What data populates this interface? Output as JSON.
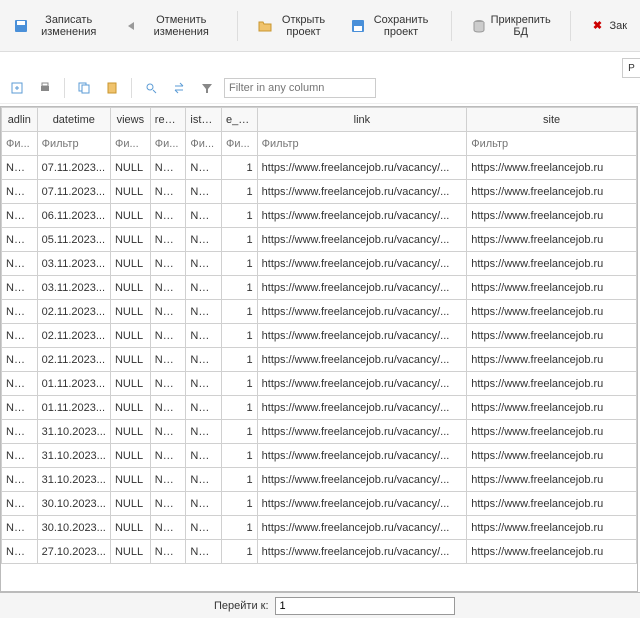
{
  "toolbar": {
    "save": "Записать изменения",
    "cancel": "Отменить изменения",
    "open": "Открыть проект",
    "saveProj": "Сохранить проект",
    "attachDb": "Прикрепить БД",
    "close": "Зак"
  },
  "tab_right": "P",
  "filter_placeholder": "Filter in any column",
  "columns": {
    "adlin": "adlin",
    "datetime": "datetime",
    "views": "views",
    "replies": "replies",
    "istom": "istomi",
    "enum": "e_num",
    "link": "link",
    "site": "site"
  },
  "filters": {
    "short": "Фи...",
    "med": "Фильтр"
  },
  "rows": [
    {
      "adlin": "NULL",
      "datetime": "07.11.2023...",
      "views": "NULL",
      "replies": "NULL",
      "istom": "NULL",
      "enum": "1",
      "link": "https://www.freelancejob.ru/vacancy/...",
      "site": "https://www.freelancejob.ru"
    },
    {
      "adlin": "NULL",
      "datetime": "07.11.2023...",
      "views": "NULL",
      "replies": "NULL",
      "istom": "NULL",
      "enum": "1",
      "link": "https://www.freelancejob.ru/vacancy/...",
      "site": "https://www.freelancejob.ru"
    },
    {
      "adlin": "NULL",
      "datetime": "06.11.2023...",
      "views": "NULL",
      "replies": "NULL",
      "istom": "NULL",
      "enum": "1",
      "link": "https://www.freelancejob.ru/vacancy/...",
      "site": "https://www.freelancejob.ru"
    },
    {
      "adlin": "NULL",
      "datetime": "05.11.2023...",
      "views": "NULL",
      "replies": "NULL",
      "istom": "NULL",
      "enum": "1",
      "link": "https://www.freelancejob.ru/vacancy/...",
      "site": "https://www.freelancejob.ru"
    },
    {
      "adlin": "NULL",
      "datetime": "03.11.2023...",
      "views": "NULL",
      "replies": "NULL",
      "istom": "NULL",
      "enum": "1",
      "link": "https://www.freelancejob.ru/vacancy/...",
      "site": "https://www.freelancejob.ru"
    },
    {
      "adlin": "NULL",
      "datetime": "03.11.2023...",
      "views": "NULL",
      "replies": "NULL",
      "istom": "NULL",
      "enum": "1",
      "link": "https://www.freelancejob.ru/vacancy/...",
      "site": "https://www.freelancejob.ru"
    },
    {
      "adlin": "NULL",
      "datetime": "02.11.2023...",
      "views": "NULL",
      "replies": "NULL",
      "istom": "NULL",
      "enum": "1",
      "link": "https://www.freelancejob.ru/vacancy/...",
      "site": "https://www.freelancejob.ru"
    },
    {
      "adlin": "NULL",
      "datetime": "02.11.2023...",
      "views": "NULL",
      "replies": "NULL",
      "istom": "NULL",
      "enum": "1",
      "link": "https://www.freelancejob.ru/vacancy/...",
      "site": "https://www.freelancejob.ru"
    },
    {
      "adlin": "NULL",
      "datetime": "02.11.2023...",
      "views": "NULL",
      "replies": "NULL",
      "istom": "NULL",
      "enum": "1",
      "link": "https://www.freelancejob.ru/vacancy/...",
      "site": "https://www.freelancejob.ru"
    },
    {
      "adlin": "NULL",
      "datetime": "01.11.2023...",
      "views": "NULL",
      "replies": "NULL",
      "istom": "NULL",
      "enum": "1",
      "link": "https://www.freelancejob.ru/vacancy/...",
      "site": "https://www.freelancejob.ru"
    },
    {
      "adlin": "NULL",
      "datetime": "01.11.2023...",
      "views": "NULL",
      "replies": "NULL",
      "istom": "NULL",
      "enum": "1",
      "link": "https://www.freelancejob.ru/vacancy/...",
      "site": "https://www.freelancejob.ru"
    },
    {
      "adlin": "NULL",
      "datetime": "31.10.2023...",
      "views": "NULL",
      "replies": "NULL",
      "istom": "NULL",
      "enum": "1",
      "link": "https://www.freelancejob.ru/vacancy/...",
      "site": "https://www.freelancejob.ru"
    },
    {
      "adlin": "NULL",
      "datetime": "31.10.2023...",
      "views": "NULL",
      "replies": "NULL",
      "istom": "NULL",
      "enum": "1",
      "link": "https://www.freelancejob.ru/vacancy/...",
      "site": "https://www.freelancejob.ru"
    },
    {
      "adlin": "NULL",
      "datetime": "31.10.2023...",
      "views": "NULL",
      "replies": "NULL",
      "istom": "NULL",
      "enum": "1",
      "link": "https://www.freelancejob.ru/vacancy/...",
      "site": "https://www.freelancejob.ru"
    },
    {
      "adlin": "NULL",
      "datetime": "30.10.2023...",
      "views": "NULL",
      "replies": "NULL",
      "istom": "NULL",
      "enum": "1",
      "link": "https://www.freelancejob.ru/vacancy/...",
      "site": "https://www.freelancejob.ru"
    },
    {
      "adlin": "NULL",
      "datetime": "30.10.2023...",
      "views": "NULL",
      "replies": "NULL",
      "istom": "NULL",
      "enum": "1",
      "link": "https://www.freelancejob.ru/vacancy/...",
      "site": "https://www.freelancejob.ru"
    },
    {
      "adlin": "NULL",
      "datetime": "27.10.2023...",
      "views": "NULL",
      "replies": "NULL",
      "istom": "NULL",
      "enum": "1",
      "link": "https://www.freelancejob.ru/vacancy/...",
      "site": "https://www.freelancejob.ru"
    }
  ],
  "status": {
    "goto_label": "Перейти к:",
    "goto_value": "1"
  }
}
